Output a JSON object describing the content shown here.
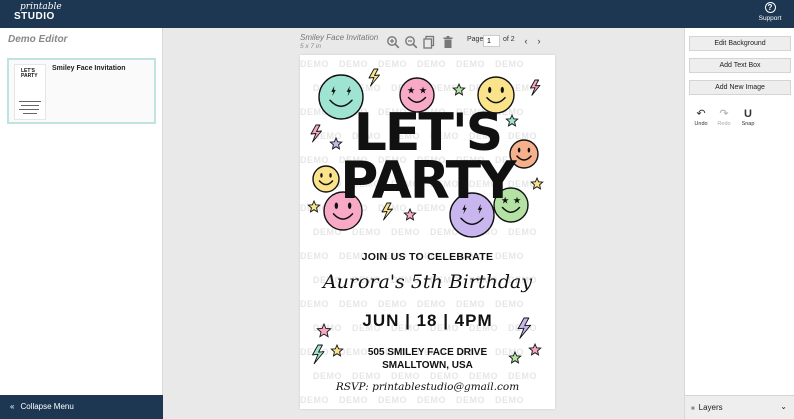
{
  "app": {
    "logo_line1": "printable",
    "logo_line2": "STUDIO",
    "support_label": "Support",
    "support_icon": "question-circle-icon"
  },
  "left_panel": {
    "title": "Demo Editor",
    "designs": [
      {
        "name": "Smiley Face Invitation",
        "thumb_text": "LET'S PARTY"
      }
    ],
    "collapse_label": "Collapse Menu"
  },
  "document": {
    "name": "Smiley Face Invitation",
    "size": "5 x 7 in",
    "page_label": "Page",
    "page_value": "1",
    "page_total_label": "of 2",
    "tools": [
      "zoom-in-icon",
      "zoom-out-icon",
      "copy-icon",
      "trash-icon"
    ]
  },
  "invitation": {
    "watermark": "DEMO",
    "headline_1": "LET'S",
    "headline_2": "PARTY",
    "join": "JOIN US TO CELEBRATE",
    "name": "Aurora's 5th Birthday",
    "date": "JUN | 18 | 4PM",
    "address_1": "505 SMILEY FACE DRIVE",
    "address_2": "SMALLTOWN, USA",
    "rsvp": "RSVP: printablestudio@gmail.com"
  },
  "right_panel": {
    "edit_background": "Edit Background",
    "add_text": "Add Text Box",
    "add_image": "Add New Image",
    "undo": "Undo",
    "redo": "Redo",
    "snap": "Snap",
    "layers": "Layers"
  },
  "colors": {
    "nav": "#1d3753",
    "smiley_teal": "#9fe3d3",
    "smiley_pink": "#f7a9c6",
    "smiley_yellow": "#fbe38c",
    "smiley_orange": "#f6b08c",
    "smiley_purple": "#c9b6ee",
    "smiley_green": "#b3e2a4"
  }
}
